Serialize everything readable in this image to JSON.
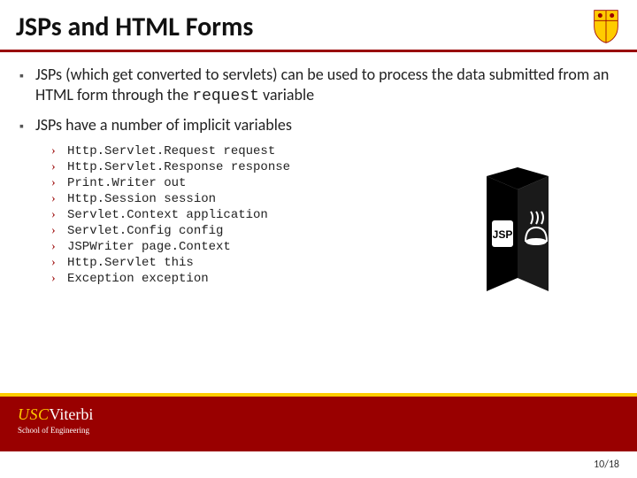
{
  "title": "JSPs and HTML Forms",
  "bullets": [
    {
      "pre": "JSPs (which get converted to servlets) can be used to process the data submitted from an HTML form through the ",
      "code": "request",
      "post": " variable"
    },
    {
      "pre": "JSPs have a number of implicit variables",
      "code": "",
      "post": ""
    }
  ],
  "variables": [
    "Http.Servlet.Request request",
    "Http.Servlet.Response response",
    "Print.Writer out",
    "Http.Session session",
    "Servlet.Context application",
    "Servlet.Config config",
    "JSPWriter page.Context",
    "Http.Servlet this",
    "Exception exception"
  ],
  "footer": {
    "usc": "USC",
    "viterbi": "Viterbi",
    "school": "School of Engineering"
  },
  "jsp_label": "JSP",
  "page": "10/18"
}
